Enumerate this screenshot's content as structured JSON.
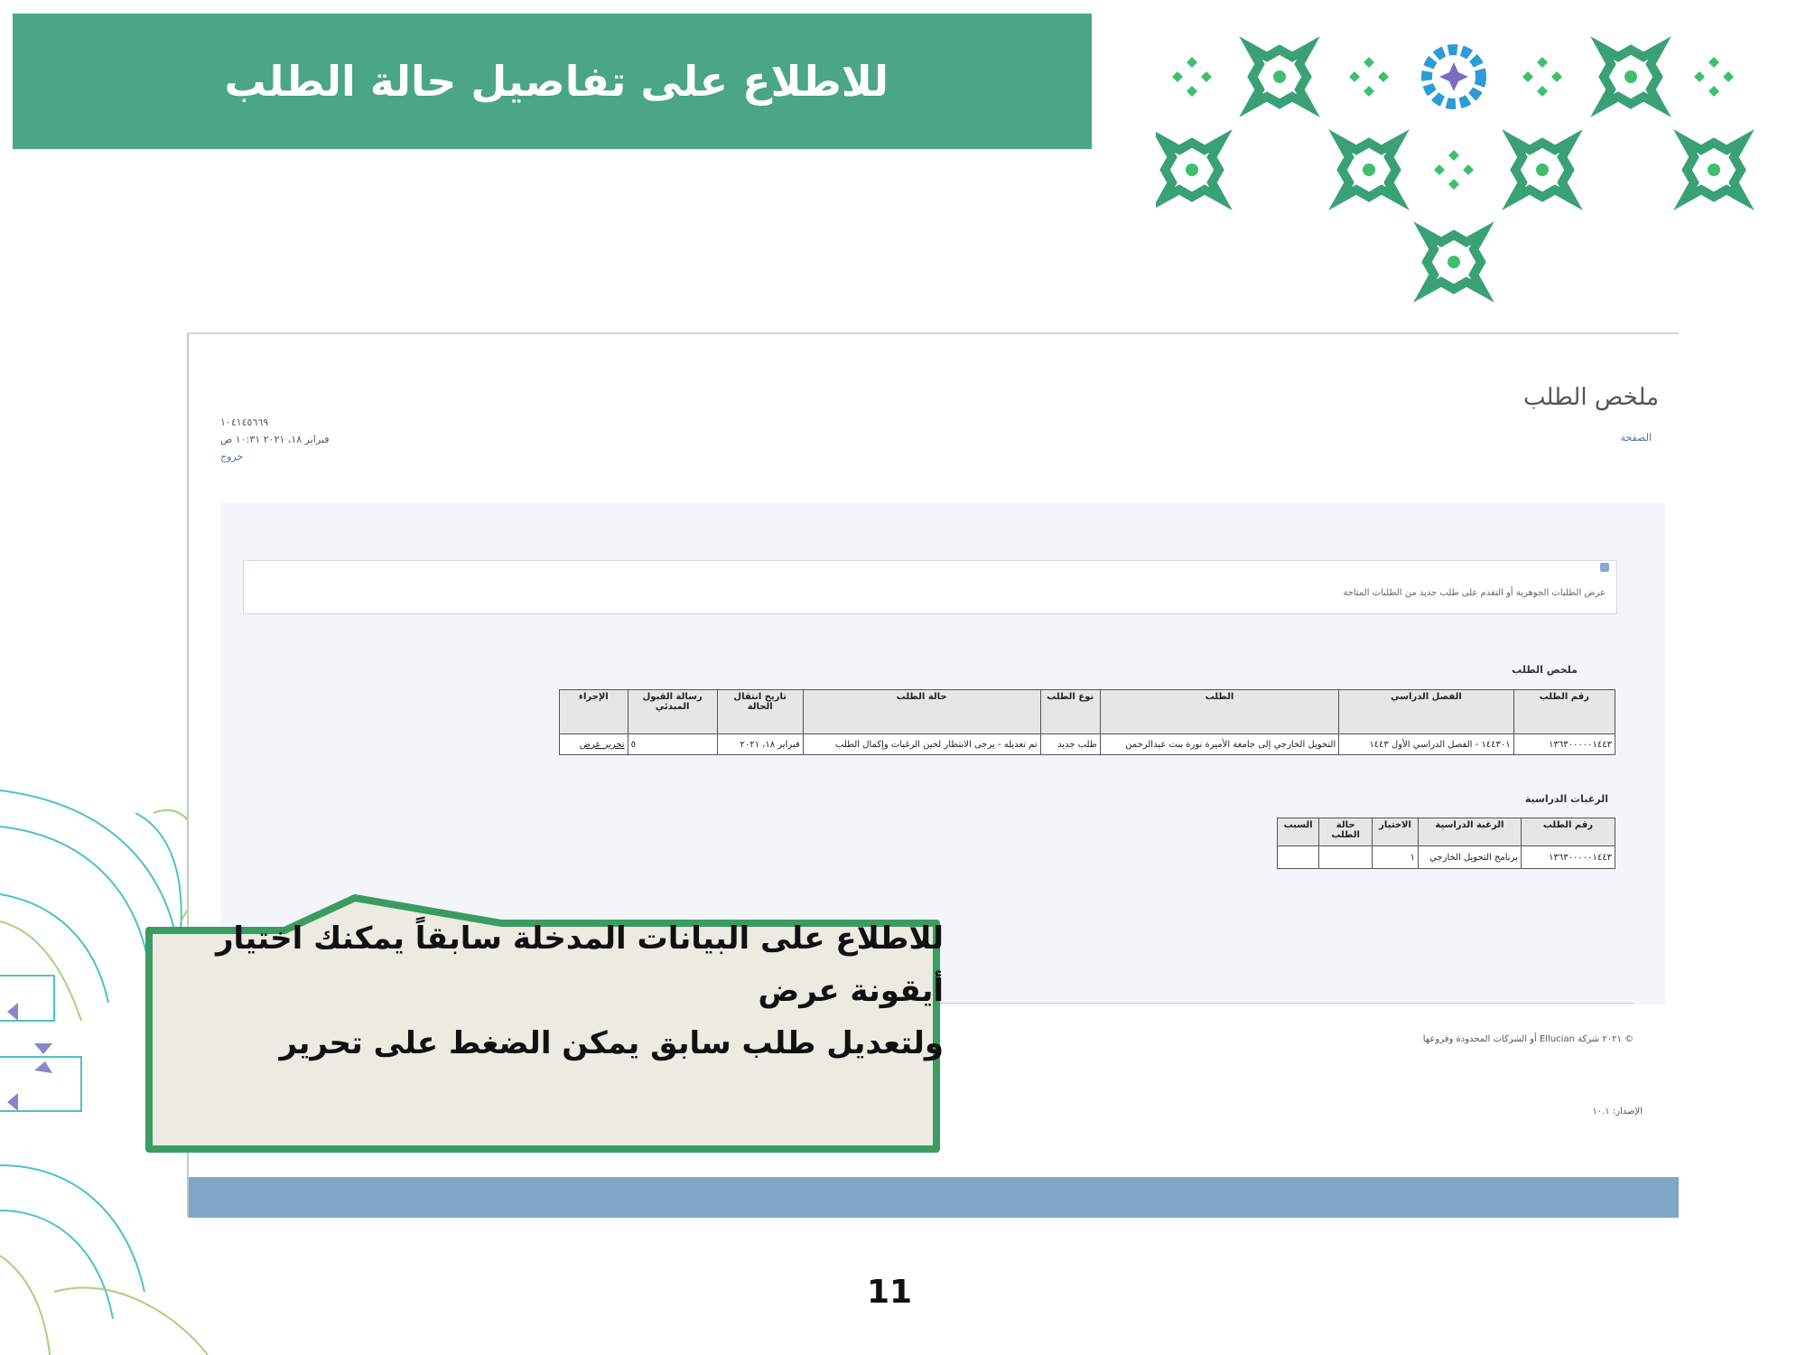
{
  "banner": {
    "title": "للاطلاع على تفاصيل حالة الطلب"
  },
  "screenshot": {
    "page_title": "ملخص الطلب",
    "breadcrumb": "الصفحة",
    "meta_line1": "١٠٤١٤٥٦٦٩",
    "meta_line2": "فبراير ١٨، ٢٠٢١ ١٠:٣١ ص",
    "logout": "خروج",
    "info_text": "عرض الطلبات الجوهرية أو التقدم على طلب جديد من الطلبات المتاحة",
    "summary_title": "ملخص الطلب",
    "summary_headers": [
      "رقم الطلب",
      "الفصل الدراسي",
      "الطلب",
      "نوع الطلب",
      "حالة الطلب",
      "تاريخ انتقال الحالة",
      "رسالة القبول المبدئي",
      "الإجراء"
    ],
    "summary_row": [
      "١٣٦٣٠٠٠٠٠١٤٤٣",
      "١٤٤٣٠١ - الفصل الدراسي الأول ١٤٤٣",
      "التحويل الخارجي إلى جامعة الأميرة نورة بنت عبدالرحمن",
      "طلب جديد",
      "تم تعديله - يرجى الانتظار لحين الرغبات وإكمال الطلب",
      "فبراير ١٨، ٢٠٢١",
      "٥",
      "تحرير عرض"
    ],
    "prefs_title": "الرغبات الدراسية",
    "prefs_headers": [
      "رقم الطلب",
      "الرغبة الدراسية",
      "الاختيار",
      "حالة الطلب",
      "السبب"
    ],
    "prefs_row": [
      "١٣٦٣٠٠٠٠٠١٤٤٣",
      "برنامج التحويل الخارجي",
      "١",
      "",
      ""
    ],
    "footer": "© ٢٠٢١ شركة Ellucian أو الشركات المحدودة وفروعها",
    "version": "الإصدار: ١٠.١"
  },
  "callout": {
    "line1": "للاطلاع على البيانات المدخلة سابقاً يمكنك اختيار",
    "line2": "أيقونة عرض",
    "line3": "ولتعديل طلب سابق يمكن الضغط على تحرير"
  },
  "page_number": "11",
  "colors": {
    "banner": "#4aa684",
    "pattern_green": "#3aa176",
    "pattern_bright": "#3fbf6e",
    "callout_fill": "#ecebe2",
    "callout_border": "#3a9c62",
    "screen_bar": "#7ea6c6"
  }
}
